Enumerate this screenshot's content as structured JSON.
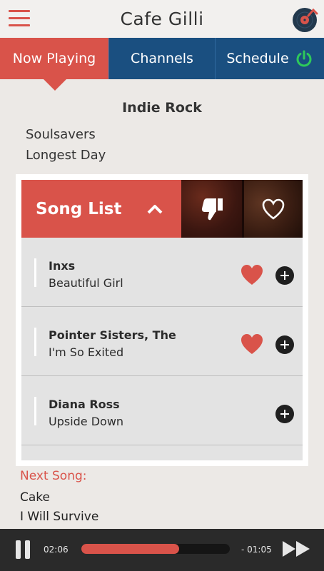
{
  "app": {
    "title": "Cafe Gilli"
  },
  "colors": {
    "accent": "#d9534a",
    "nav_blue": "#1a4f80",
    "power_green": "#2ec95a"
  },
  "tabs": [
    {
      "label": "Now Playing",
      "active": true
    },
    {
      "label": "Channels",
      "active": false
    },
    {
      "label": "Schedule",
      "active": false
    }
  ],
  "now_playing": {
    "genre": "Indie Rock",
    "artist": "Soulsavers",
    "title": "Longest Day"
  },
  "song_list": {
    "header_label": "Song List",
    "songs": [
      {
        "artist": "Inxs",
        "title": "Beautiful Girl",
        "liked": true
      },
      {
        "artist": "Pointer Sisters, The",
        "title": "I'm So Exited",
        "liked": true
      },
      {
        "artist": "Diana Ross",
        "title": "Upside Down",
        "liked": false
      }
    ]
  },
  "next_song": {
    "label": "Next Song:",
    "artist": "Cake",
    "title": "I Will Survive"
  },
  "player": {
    "elapsed": "02:06",
    "remaining": "- 01:05",
    "progress_fraction": 0.66
  },
  "icons": {
    "menu": "hamburger-menu-icon",
    "logo": "vinyl-record-logo-icon",
    "power": "power-icon",
    "collapse": "chevron-up-icon",
    "dislike": "thumbs-down-icon",
    "like": "heart-outline-icon",
    "liked": "heart-filled-icon",
    "add": "plus-circle-icon",
    "pause": "pause-icon",
    "next": "fast-forward-icon"
  }
}
